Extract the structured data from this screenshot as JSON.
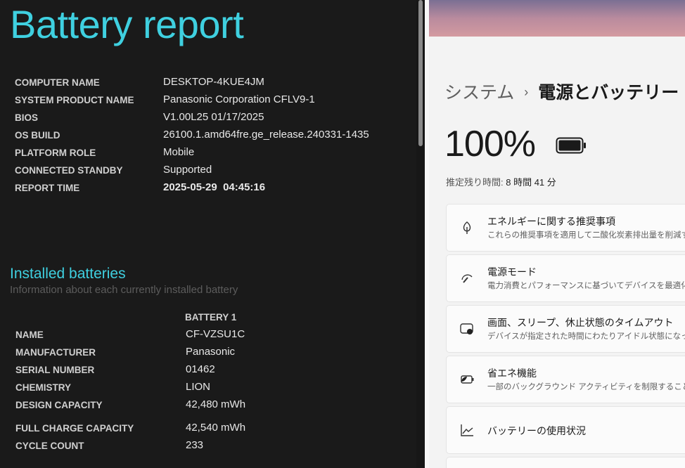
{
  "report": {
    "title": "Battery report",
    "system": [
      {
        "label": "COMPUTER NAME",
        "value": "DESKTOP-4KUE4JM"
      },
      {
        "label": "SYSTEM PRODUCT NAME",
        "value": "Panasonic Corporation CFLV9-1"
      },
      {
        "label": "BIOS",
        "value": "V1.00L25 01/17/2025"
      },
      {
        "label": "OS BUILD",
        "value": "26100.1.amd64fre.ge_release.240331-1435"
      },
      {
        "label": "PLATFORM ROLE",
        "value": "Mobile"
      },
      {
        "label": "CONNECTED STANDBY",
        "value": "Supported"
      },
      {
        "label": "REPORT TIME",
        "value": "2025-05-29  04:45:16"
      }
    ],
    "installed": {
      "heading": "Installed batteries",
      "subtitle": "Information about each currently installed battery",
      "column": "BATTERY 1",
      "rows": [
        {
          "label": "NAME",
          "value": "CF-VZSU1C"
        },
        {
          "label": "MANUFACTURER",
          "value": "Panasonic"
        },
        {
          "label": "SERIAL NUMBER",
          "value": "01462"
        },
        {
          "label": "CHEMISTRY",
          "value": "LION"
        },
        {
          "label": "DESIGN CAPACITY",
          "value": "42,480 mWh"
        },
        {
          "label": "FULL CHARGE CAPACITY",
          "value": "42,540 mWh"
        },
        {
          "label": "CYCLE COUNT",
          "value": "233"
        }
      ]
    }
  },
  "settings": {
    "breadcrumb_parent": "システム",
    "breadcrumb_sep": "›",
    "breadcrumb_current": "電源とバッテリー",
    "percent": "100%",
    "estimate_label": "推定残り時間:",
    "estimate_value": "8 時間 41 分",
    "cards": [
      {
        "title": "エネルギーに関する推奨事項",
        "desc": "これらの推奨事項を適用して二酸化炭素排出量を削減する",
        "icon": "leaf-icon"
      },
      {
        "title": "電源モード",
        "desc": "電力消費とパフォーマンスに基づいてデバイスを最適化",
        "icon": "gauge-icon"
      },
      {
        "title": "画面、スリープ、休止状態のタイムアウト",
        "desc": "デバイスが指定された時間にわたりアイドル状態になった場合",
        "icon": "screen-sleep-icon"
      },
      {
        "title": "省エネ機能",
        "desc": "一部のバックグラウンド アクティビティを制限することで、電力消",
        "icon": "battery-saver-icon"
      },
      {
        "title": "バッテリーの使用状況",
        "desc": "",
        "icon": "chart-icon"
      }
    ]
  },
  "colors": {
    "accent": "#3fd0e0",
    "dark_bg": "#1a1a1a",
    "light_bg": "#f3f3f3"
  }
}
